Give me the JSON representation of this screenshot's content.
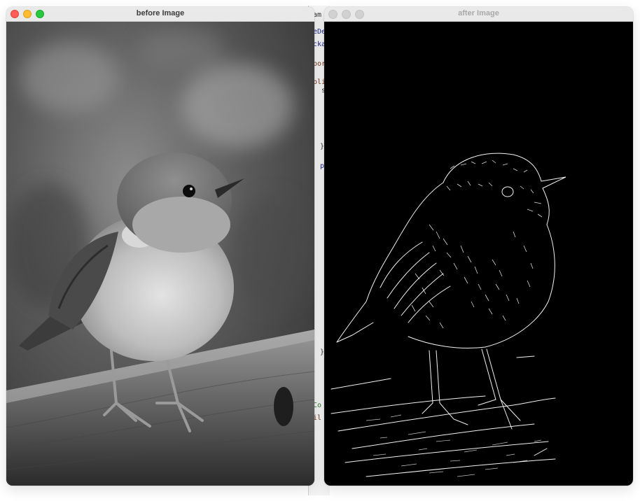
{
  "windows": {
    "before": {
      "title": "before Image",
      "controls": [
        "close",
        "minimize",
        "zoom"
      ],
      "image": {
        "subject": "bird-grayscale",
        "mode": "grayscale"
      }
    },
    "after": {
      "title": "after Image",
      "controls": [
        "close",
        "minimize",
        "zoom"
      ],
      "state": "inactive",
      "image": {
        "subject": "bird-edges",
        "mode": "edge-detected"
      }
    }
  },
  "background_editor": {
    "fragments": [
      "am",
      "eDe",
      "cka",
      "por",
      "bli",
      "s",
      "}",
      "p",
      "}",
      "Co",
      "il"
    ]
  },
  "colors": {
    "close": "#ff5f57",
    "minimize": "#febc2e",
    "zoom": "#28c840",
    "inactive_control": "#d1d1d1",
    "edge_background": "#000000",
    "edge_line": "#ffffff"
  }
}
